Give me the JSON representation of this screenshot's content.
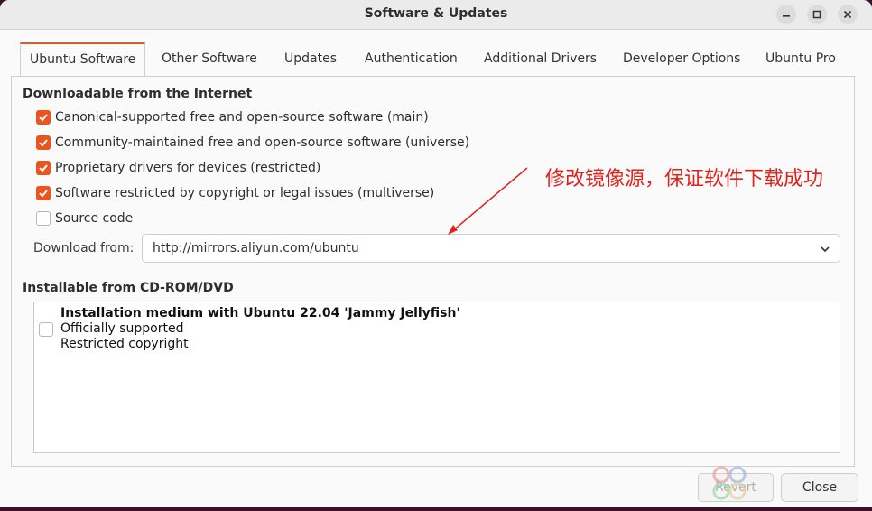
{
  "window": {
    "title": "Software & Updates"
  },
  "tabs": [
    {
      "label": "Ubuntu Software",
      "active": true
    },
    {
      "label": "Other Software",
      "active": false
    },
    {
      "label": "Updates",
      "active": false
    },
    {
      "label": "Authentication",
      "active": false
    },
    {
      "label": "Additional Drivers",
      "active": false
    },
    {
      "label": "Developer Options",
      "active": false
    },
    {
      "label": "Ubuntu Pro",
      "active": false
    }
  ],
  "internet": {
    "heading": "Downloadable from the Internet",
    "options": [
      {
        "label": "Canonical-supported free and open-source software (main)",
        "checked": true
      },
      {
        "label": "Community-maintained free and open-source software (universe)",
        "checked": true
      },
      {
        "label": "Proprietary drivers for devices (restricted)",
        "checked": true
      },
      {
        "label": "Software restricted by copyright or legal issues (multiverse)",
        "checked": true
      },
      {
        "label": "Source code",
        "checked": false
      }
    ],
    "download_from_label": "Download from:",
    "download_from_value": "http://mirrors.aliyun.com/ubuntu"
  },
  "cdrom": {
    "heading": "Installable from CD-ROM/DVD",
    "item": {
      "title": "Installation medium with Ubuntu 22.04 'Jammy Jellyfish'",
      "line1": "Officially supported",
      "line2": "Restricted copyright",
      "checked": false
    }
  },
  "buttons": {
    "revert": "Revert",
    "close": "Close"
  },
  "annotation": {
    "text": "修改镜像源，保证软件下载成功",
    "color": "#e0221b"
  },
  "colors": {
    "accent": "#e95420"
  },
  "icons": {
    "minimize": "minimize-icon",
    "maximize": "maximize-icon",
    "close": "close-icon",
    "dropdown": "chevron-down-icon",
    "check": "checkmark-icon"
  }
}
